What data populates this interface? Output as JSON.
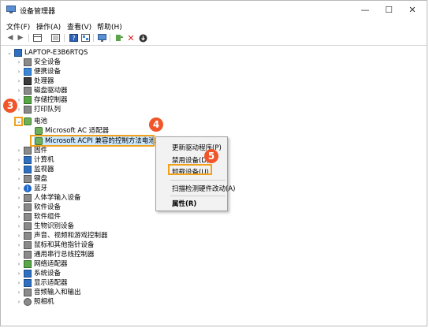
{
  "window": {
    "title": "设备管理器",
    "minimize_glyph": "—",
    "maximize_glyph": "☐",
    "close_glyph": "✕"
  },
  "menu": [
    "文件(F)",
    "操作(A)",
    "查看(V)",
    "帮助(H)"
  ],
  "toolbar": [
    "back-icon",
    "forward-icon",
    "grid-icon",
    "properties-icon",
    "help-icon",
    "devices-icon",
    "monitor-icon",
    "update-driver-icon",
    "uninstall-icon",
    "download-icon"
  ],
  "tree": {
    "root": "LAPTOP-E3B6RTQS",
    "battery_label": "电池",
    "battery_children": [
      "Microsoft AC 适配器",
      "Microsoft ACPI 兼容的控制方法电池"
    ],
    "categories_before": [
      "安全设备",
      "便携设备",
      "处理器",
      "磁盘驱动器",
      "存储控制器",
      "打印队列"
    ],
    "categories_after": [
      "固件",
      "计算机",
      "监视器",
      "键盘",
      "蓝牙",
      "人体学输入设备",
      "软件设备",
      "软件组件",
      "生物识别设备",
      "声音、视频和游戏控制器",
      "鼠标和其他指针设备",
      "通用串行总线控制器",
      "网络适配器",
      "系统设备",
      "显示适配器",
      "音频输入和输出",
      "照相机"
    ]
  },
  "context_menu": {
    "items": [
      "更新驱动程序(P)",
      "禁用设备(D)",
      "卸载设备(U)",
      "扫描检测硬件改动(A)",
      "属性(R)"
    ]
  },
  "badges": [
    "3",
    "4",
    "5"
  ],
  "colors": {
    "highlight": "#f0a21c",
    "badge": "#f0562a",
    "selection": "#cce8ff"
  }
}
